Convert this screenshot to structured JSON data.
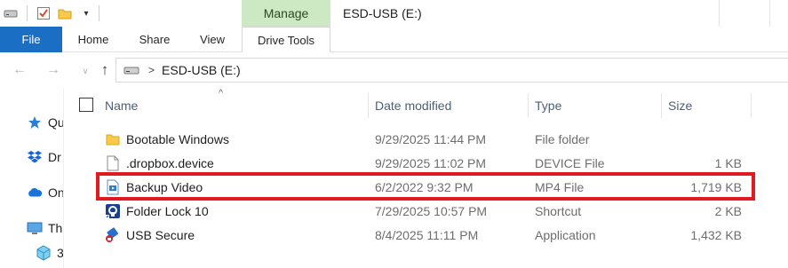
{
  "window": {
    "title": "ESD-USB (E:)",
    "context_tab": "Manage"
  },
  "ribbon": {
    "tabs": [
      {
        "label": "File"
      },
      {
        "label": "Home"
      },
      {
        "label": "Share"
      },
      {
        "label": "View"
      },
      {
        "label": "Drive Tools"
      }
    ]
  },
  "address": {
    "path": [
      "ESD-USB (E:)"
    ]
  },
  "navpane": {
    "items": [
      {
        "label": "Qu",
        "icon": "star-icon"
      },
      {
        "label": "Dr",
        "icon": "dropbox-icon"
      },
      {
        "label": "On",
        "icon": "onedrive-cloud-icon"
      },
      {
        "label": "Th",
        "icon": "this-pc-icon"
      },
      {
        "label": "3",
        "icon": "3d-objects-icon"
      }
    ]
  },
  "filelist": {
    "columns": {
      "name": "Name",
      "date": "Date modified",
      "type": "Type",
      "size": "Size"
    },
    "rows": [
      {
        "name": "Bootable Windows",
        "date": "9/29/2025 11:44 PM",
        "type": "File folder",
        "size": "",
        "icon": "folder-icon"
      },
      {
        "name": ".dropbox.device",
        "date": "9/29/2025 11:02 PM",
        "type": "DEVICE File",
        "size": "1 KB",
        "icon": "blank-file-icon"
      },
      {
        "name": "Backup Video",
        "date": "6/2/2022 9:32 PM",
        "type": "MP4 File",
        "size": "1,719 KB",
        "icon": "video-file-icon"
      },
      {
        "name": "Folder Lock 10",
        "date": "7/29/2025 10:57 PM",
        "type": "Shortcut",
        "size": "2 KB",
        "icon": "folder-lock-app-icon"
      },
      {
        "name": "USB Secure",
        "date": "8/4/2025 11:11 PM",
        "type": "Application",
        "size": "1,432 KB",
        "icon": "usb-secure-app-icon"
      }
    ],
    "highlighted_row": "Backup Video"
  },
  "colors": {
    "file_tab": "#1a6fc4",
    "manage_tab": "#cde9c3",
    "highlight_border": "#e11a22",
    "header_text": "#4c607a"
  }
}
